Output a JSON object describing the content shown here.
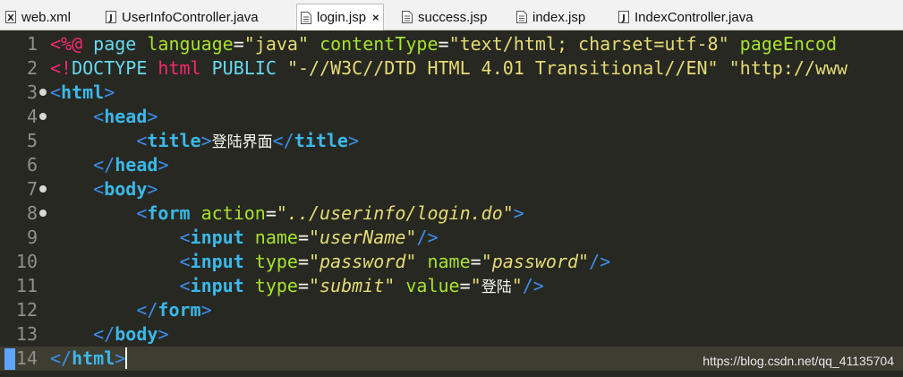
{
  "tabs": [
    {
      "label": "web.xml",
      "icon": "xml-file-icon",
      "active": false
    },
    {
      "label": "UserInfoController.java",
      "icon": "java-file-icon",
      "active": false
    },
    {
      "label": "login.jsp",
      "icon": "jsp-file-icon",
      "active": true
    },
    {
      "label": "success.jsp",
      "icon": "jsp-file-icon",
      "active": false
    },
    {
      "label": "index.jsp",
      "icon": "jsp-file-icon",
      "active": false
    },
    {
      "label": "IndexController.java",
      "icon": "java-file-icon",
      "active": false
    }
  ],
  "close_glyph": "×",
  "lines": [
    {
      "n": "1",
      "fold": false,
      "tokens": [
        [
          "t-tag",
          "<%@ "
        ],
        [
          "t-kw",
          "page "
        ],
        [
          "t-attr",
          "language"
        ],
        [
          "t-plain",
          "="
        ],
        [
          "t-str",
          "\"java\" "
        ],
        [
          "t-attr",
          "contentType"
        ],
        [
          "t-plain",
          "="
        ],
        [
          "t-str",
          "\"text/html; charset=utf-8\" "
        ],
        [
          "t-attr",
          "pageEncod"
        ]
      ]
    },
    {
      "n": "2",
      "fold": false,
      "tokens": [
        [
          "t-tag",
          "<!"
        ],
        [
          "t-pkw",
          "DOCTYPE "
        ],
        [
          "t-tag",
          "html "
        ],
        [
          "t-pkw",
          "PUBLIC "
        ],
        [
          "t-str",
          "\"-//W3C//DTD HTML 4.01 Transitional//EN\" \"http://www"
        ]
      ]
    },
    {
      "n": "3",
      "fold": true,
      "tokens": [
        [
          "t-br",
          "<"
        ],
        [
          "t-name",
          "html"
        ],
        [
          "t-br",
          ">"
        ]
      ]
    },
    {
      "n": "4",
      "fold": true,
      "tokens": [
        [
          "t-plain",
          "    "
        ],
        [
          "t-br",
          "<"
        ],
        [
          "t-name",
          "head"
        ],
        [
          "t-br",
          ">"
        ]
      ]
    },
    {
      "n": "5",
      "fold": false,
      "tokens": [
        [
          "t-plain",
          "        "
        ],
        [
          "t-br",
          "<"
        ],
        [
          "t-name",
          "title"
        ],
        [
          "t-br",
          ">"
        ],
        [
          "t-cn",
          "登陆界面"
        ],
        [
          "t-br",
          "</"
        ],
        [
          "t-name",
          "title"
        ],
        [
          "t-br",
          ">"
        ]
      ]
    },
    {
      "n": "6",
      "fold": false,
      "tokens": [
        [
          "t-plain",
          "    "
        ],
        [
          "t-br",
          "</"
        ],
        [
          "t-name",
          "head"
        ],
        [
          "t-br",
          ">"
        ]
      ]
    },
    {
      "n": "7",
      "fold": true,
      "tokens": [
        [
          "t-plain",
          "    "
        ],
        [
          "t-br",
          "<"
        ],
        [
          "t-name",
          "body"
        ],
        [
          "t-br",
          ">"
        ]
      ]
    },
    {
      "n": "8",
      "fold": true,
      "tokens": [
        [
          "t-plain",
          "        "
        ],
        [
          "t-br",
          "<"
        ],
        [
          "t-name",
          "form "
        ],
        [
          "t-attr",
          "action"
        ],
        [
          "t-plain",
          "="
        ],
        [
          "t-istr",
          "\"../userinfo/login.do\""
        ],
        [
          "t-br",
          ">"
        ]
      ]
    },
    {
      "n": "9",
      "fold": false,
      "tokens": [
        [
          "t-plain",
          "            "
        ],
        [
          "t-br",
          "<"
        ],
        [
          "t-name",
          "input "
        ],
        [
          "t-attr",
          "name"
        ],
        [
          "t-plain",
          "="
        ],
        [
          "t-istr",
          "\"userName\""
        ],
        [
          "t-br",
          "/>"
        ]
      ]
    },
    {
      "n": "10",
      "fold": false,
      "tokens": [
        [
          "t-plain",
          "            "
        ],
        [
          "t-br",
          "<"
        ],
        [
          "t-name",
          "input "
        ],
        [
          "t-attr",
          "type"
        ],
        [
          "t-plain",
          "="
        ],
        [
          "t-istr",
          "\"password\" "
        ],
        [
          "t-attr",
          "name"
        ],
        [
          "t-plain",
          "="
        ],
        [
          "t-istr",
          "\"password\""
        ],
        [
          "t-br",
          "/>"
        ]
      ]
    },
    {
      "n": "11",
      "fold": false,
      "tokens": [
        [
          "t-plain",
          "            "
        ],
        [
          "t-br",
          "<"
        ],
        [
          "t-name",
          "input "
        ],
        [
          "t-attr",
          "type"
        ],
        [
          "t-plain",
          "="
        ],
        [
          "t-istr",
          "\"submit\" "
        ],
        [
          "t-attr",
          "value"
        ],
        [
          "t-plain",
          "="
        ],
        [
          "t-istr",
          "\""
        ],
        [
          "t-cn",
          "登陆"
        ],
        [
          "t-istr",
          "\""
        ],
        [
          "t-br",
          "/>"
        ]
      ]
    },
    {
      "n": "12",
      "fold": false,
      "tokens": [
        [
          "t-plain",
          "        "
        ],
        [
          "t-br",
          "</"
        ],
        [
          "t-name",
          "form"
        ],
        [
          "t-br",
          ">"
        ]
      ]
    },
    {
      "n": "13",
      "fold": false,
      "tokens": [
        [
          "t-plain",
          "    "
        ],
        [
          "t-br",
          "</"
        ],
        [
          "t-name",
          "body"
        ],
        [
          "t-br",
          ">"
        ]
      ]
    },
    {
      "n": "14",
      "fold": false,
      "current": true,
      "tokens": [
        [
          "t-br",
          "</"
        ],
        [
          "t-name",
          "html"
        ],
        [
          "t-br",
          ">"
        ]
      ]
    }
  ],
  "watermark": "https://blog.csdn.net/qq_41135704",
  "colors": {
    "background": "#272822",
    "current_line": "#3e3d32",
    "tag": "#3b8eea",
    "attribute": "#a6e22e",
    "string": "#e6db74"
  }
}
